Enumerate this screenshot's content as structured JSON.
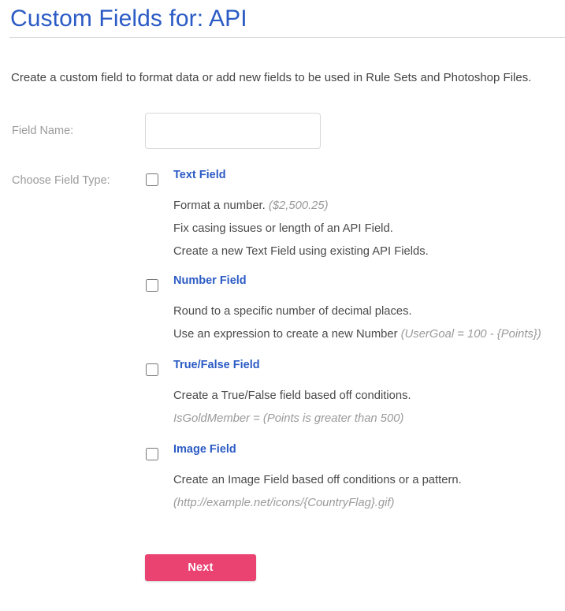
{
  "header": {
    "title": "Custom Fields for: API"
  },
  "intro": {
    "text": "Create a custom field to format data or add new fields to be used in Rule Sets and Photoshop Files."
  },
  "form": {
    "field_name_label": "Field Name:",
    "field_name_value": "",
    "field_name_placeholder": "",
    "choose_type_label": "Choose Field Type:"
  },
  "field_types": [
    {
      "id": "text",
      "label": "Text Field",
      "checked": false,
      "lines": [
        {
          "text": "Format a number. ",
          "example": "($2,500.25)"
        },
        {
          "text": "Fix casing issues or length of an API Field.",
          "example": ""
        },
        {
          "text": "Create a new Text Field using existing API Fields.",
          "example": ""
        }
      ]
    },
    {
      "id": "number",
      "label": "Number Field",
      "checked": false,
      "lines": [
        {
          "text": "Round to a specific number of decimal places.",
          "example": ""
        },
        {
          "text": "Use an expression to create a new Number ",
          "example": "(UserGoal = 100 - {Points})"
        }
      ]
    },
    {
      "id": "boolean",
      "label": "True/False Field",
      "checked": false,
      "lines": [
        {
          "text": "Create a True/False field based off conditions.",
          "example": ""
        },
        {
          "text": "",
          "example": "IsGoldMember = (Points is greater than 500)"
        }
      ]
    },
    {
      "id": "image",
      "label": "Image Field",
      "checked": false,
      "lines": [
        {
          "text": "Create an Image Field based off conditions or a pattern.",
          "example": ""
        },
        {
          "text": "",
          "example": "(http://example.net/icons/{CountryFlag}.gif)"
        }
      ]
    }
  ],
  "actions": {
    "next_label": "Next"
  },
  "colors": {
    "title_blue": "#2b5bc4",
    "link_blue": "#2b5bc4",
    "button_pink": "#ea4371",
    "label_gray": "#9b9b9b",
    "body_gray": "#444444",
    "example_gray": "#9a9a9a",
    "rule_gray": "#d9dadb",
    "input_border": "#d6d7d8",
    "checkbox_border": "#545454"
  }
}
